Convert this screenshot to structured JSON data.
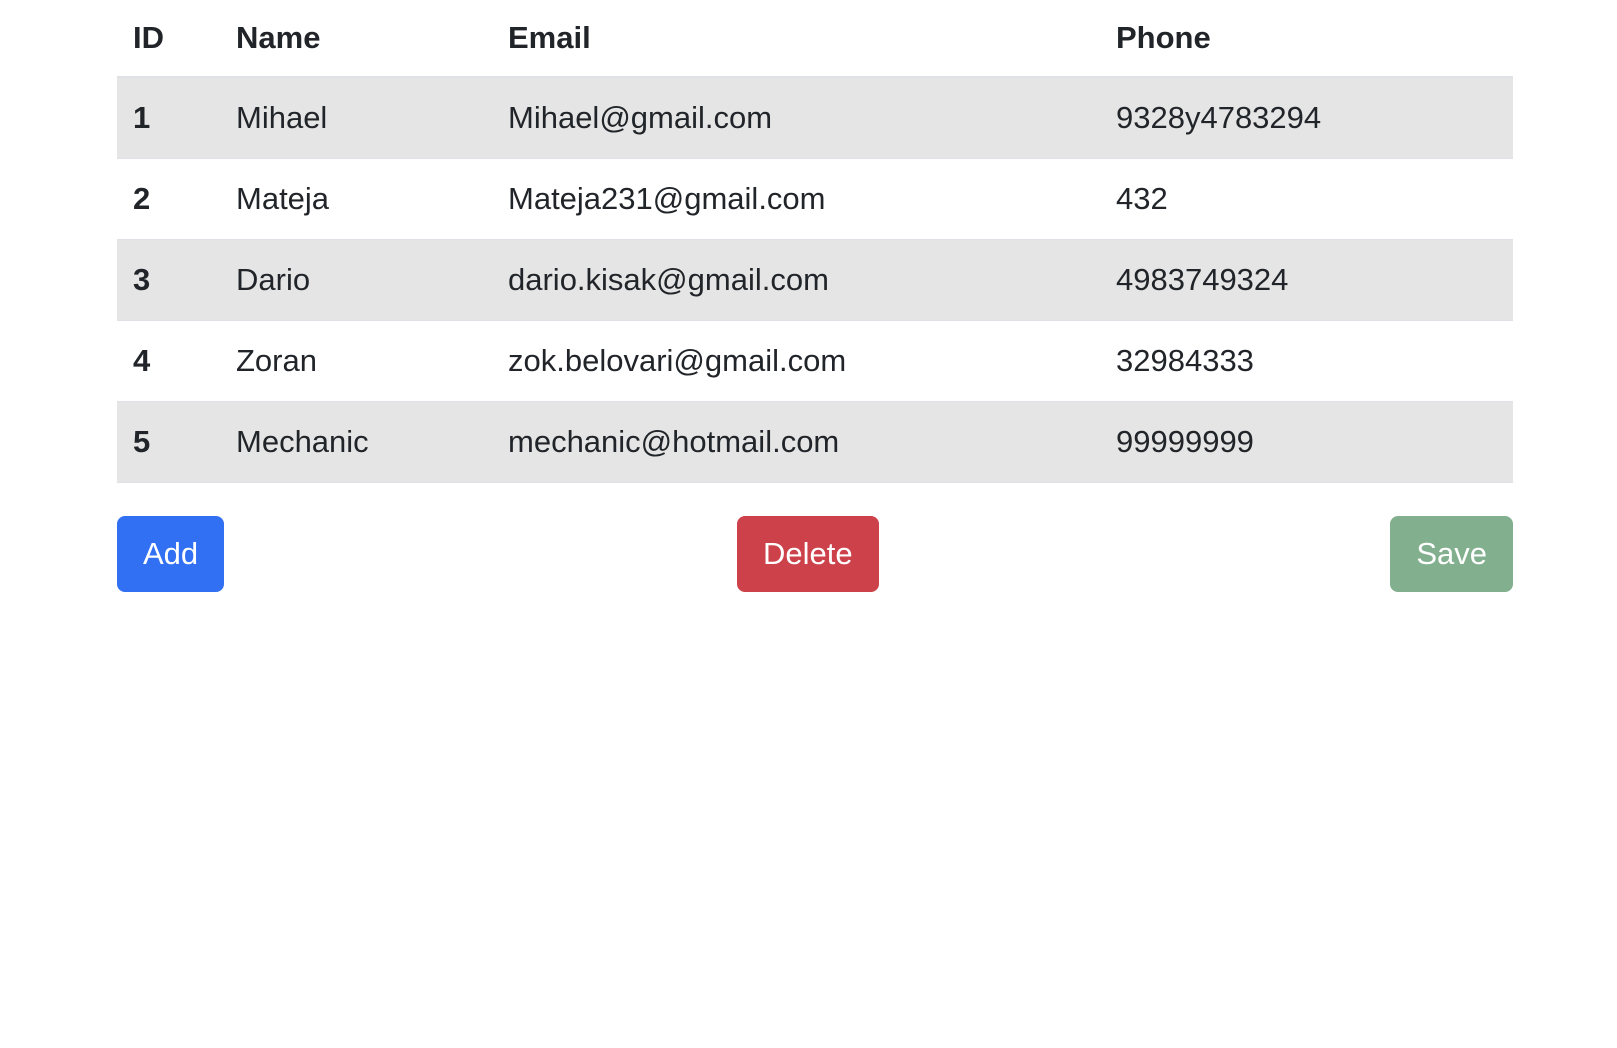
{
  "table": {
    "headers": {
      "id": "ID",
      "name": "Name",
      "email": "Email",
      "phone": "Phone"
    },
    "rows": [
      {
        "id": "1",
        "name": "Mihael",
        "email": "Mihael@gmail.com",
        "phone": "9328y4783294"
      },
      {
        "id": "2",
        "name": "Mateja",
        "email": "Mateja231@gmail.com",
        "phone": "432"
      },
      {
        "id": "3",
        "name": "Dario",
        "email": "dario.kisak@gmail.com",
        "phone": "4983749324"
      },
      {
        "id": "4",
        "name": "Zoran",
        "email": "zok.belovari@gmail.com",
        "phone": "32984333"
      },
      {
        "id": "5",
        "name": "Mechanic",
        "email": "mechanic@hotmail.com",
        "phone": "99999999"
      }
    ]
  },
  "actions": {
    "add_label": "Add",
    "delete_label": "Delete",
    "save_label": "Save"
  },
  "colors": {
    "add": "#316ff3",
    "delete": "#cd424a",
    "save": "#82b08f",
    "striped_row": "#e5e5e5"
  }
}
